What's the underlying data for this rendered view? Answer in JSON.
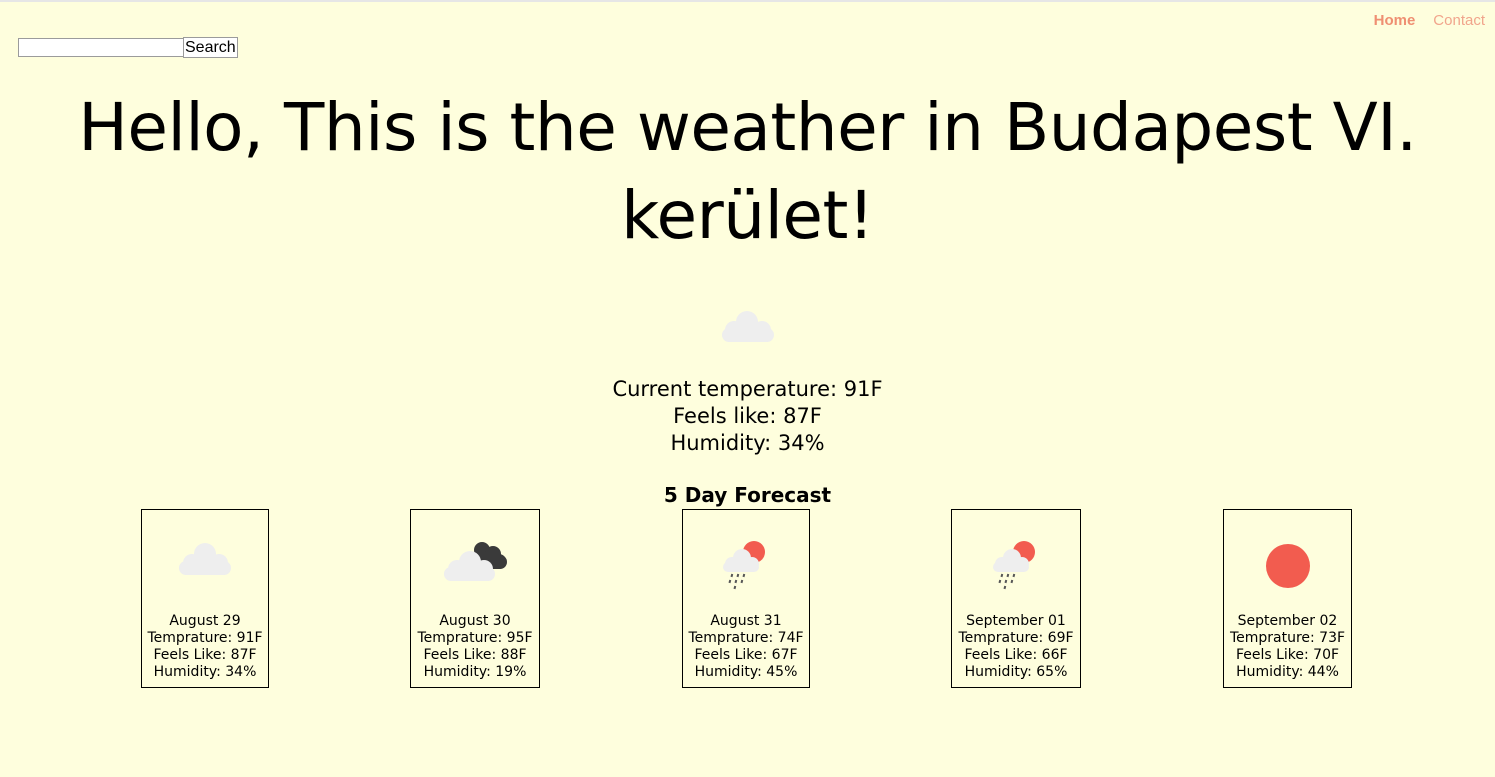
{
  "nav": {
    "home": "Home",
    "contact": "Contact"
  },
  "search": {
    "button_label": "Search",
    "value": ""
  },
  "hero_title": "Hello, This is the weather in Budapest VI. kerület!",
  "current": {
    "icon": "cloud-icon",
    "temperature": "Current temperature: 91F",
    "feels_like": "Feels like: 87F",
    "humidity": "Humidity: 34%"
  },
  "forecast_title": "5 Day Forecast",
  "forecast": [
    {
      "icon": "cloud-icon",
      "date": "August 29",
      "temp": "Temprature: 91F",
      "feels": "Feels Like: 87F",
      "humidity": "Humidity: 34%"
    },
    {
      "icon": "dark-clouds-icon",
      "date": "August 30",
      "temp": "Temprature: 95F",
      "feels": "Feels Like: 88F",
      "humidity": "Humidity: 19%"
    },
    {
      "icon": "sun-rain-icon",
      "date": "August 31",
      "temp": "Temprature: 74F",
      "feels": "Feels Like: 67F",
      "humidity": "Humidity: 45%"
    },
    {
      "icon": "sun-rain-icon",
      "date": "September 01",
      "temp": "Temprature: 69F",
      "feels": "Feels Like: 66F",
      "humidity": "Humidity: 65%"
    },
    {
      "icon": "sun-icon",
      "date": "September 02",
      "temp": "Temprature: 73F",
      "feels": "Feels Like: 70F",
      "humidity": "Humidity: 44%"
    }
  ],
  "colors": {
    "background": "#fefedd",
    "nav_link": "#ef8f72",
    "sun": "#f25c4f",
    "cloud": "#eeeeee",
    "dark_cloud": "#3a3a3a"
  }
}
